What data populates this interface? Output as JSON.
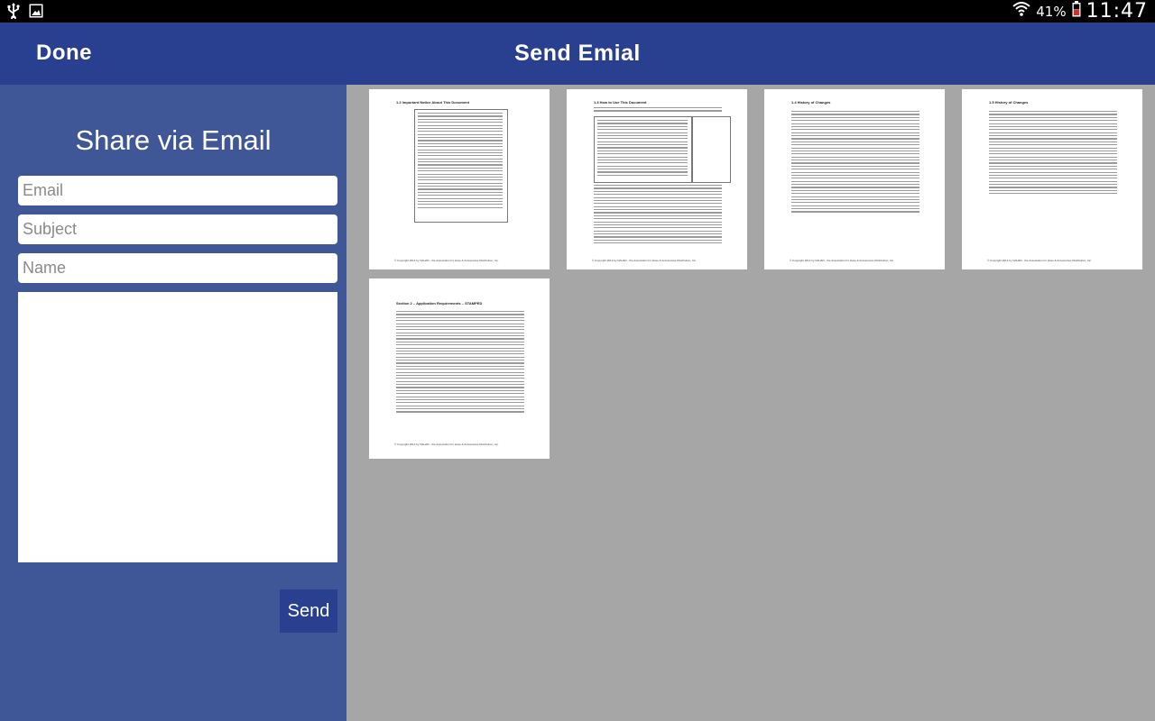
{
  "status_bar": {
    "left_icons": [
      "usb-icon",
      "image-icon"
    ],
    "right_icons": [
      "wifi-icon",
      "battery-icon"
    ],
    "battery_percent": "41%",
    "time": "11:47"
  },
  "action_bar": {
    "done_label": "Done",
    "title": "Send Emial"
  },
  "share_form": {
    "heading": "Share via Email",
    "email_placeholder": "Email",
    "subject_placeholder": "Subject",
    "name_placeholder": "Name",
    "message_value": "",
    "send_label": "Send"
  },
  "pages": [
    {
      "heading": "1.2 Important Notice About This Document",
      "footer": "© Copyright 2014 by NAHAD - the Association for Hose & Accessories Distribution, Inc."
    },
    {
      "heading": "1.3 How to Use This Document",
      "footer": "© Copyright 2014 by NAHAD - the Association for Hose & Accessories Distribution, Inc."
    },
    {
      "heading": "1.4 History of Changes",
      "footer": "© Copyright 2014 by NAHAD - the Association for Hose & Accessories Distribution, Inc."
    },
    {
      "heading": "1.5 History of Changes",
      "footer": "© Copyright 2014 by NAHAD - the Association for Hose & Accessories Distribution, Inc."
    },
    {
      "heading": "Section 2 – Application Requirements – STAMPED",
      "footer": "© Copyright 2014 by NAHAD - the Association for Hose & Accessories Distribution, Inc."
    }
  ]
}
